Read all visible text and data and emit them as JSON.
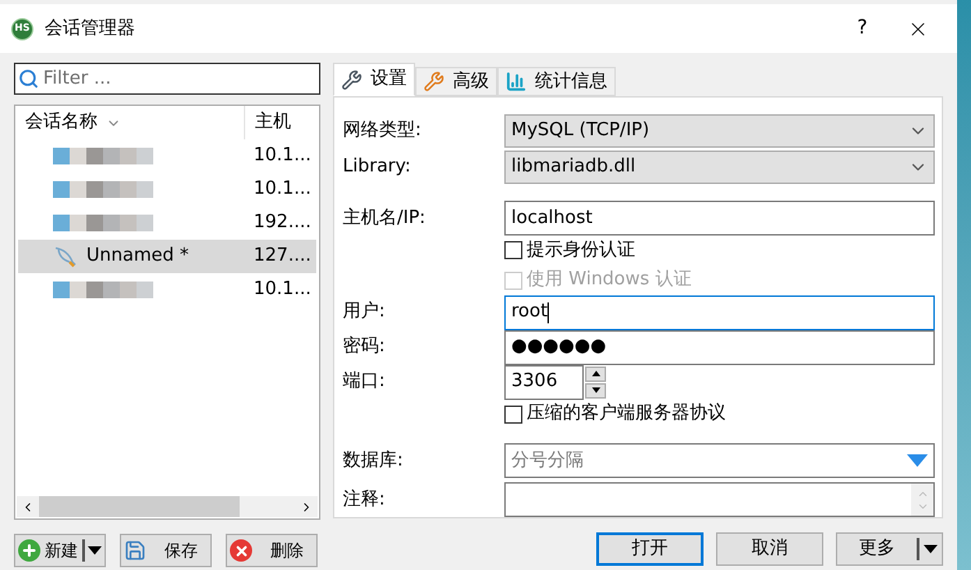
{
  "window": {
    "logo_text": "HS",
    "title": "会话管理器",
    "help": "?"
  },
  "filter": {
    "placeholder": "Filter ..."
  },
  "columns": [
    {
      "label": "会话名称",
      "sorted": true
    },
    {
      "label": "主机",
      "sorted": false
    }
  ],
  "sessions": [
    {
      "kind": "blurred",
      "host": "10.1...",
      "selected": false
    },
    {
      "kind": "blurred",
      "host": "10.1...",
      "selected": false
    },
    {
      "kind": "blurred",
      "host": "192....",
      "selected": false
    },
    {
      "kind": "named",
      "name": "Unnamed *",
      "host": "127....",
      "selected": true
    },
    {
      "kind": "blurred",
      "host": "10.1...",
      "selected": false
    }
  ],
  "left_buttons": [
    {
      "kind": "new",
      "label": "新建",
      "dropdown": true
    },
    {
      "kind": "save",
      "label": "保存",
      "dropdown": false
    },
    {
      "kind": "delete",
      "label": "删除",
      "dropdown": false
    }
  ],
  "tabs": [
    {
      "kind": "settings",
      "label": "设置",
      "selected": true
    },
    {
      "kind": "advanced",
      "label": "高级",
      "selected": false
    },
    {
      "kind": "stats",
      "label": "统计信息",
      "selected": false
    }
  ],
  "form": [
    {
      "kind": "select",
      "label": "网络类型:",
      "value": "MySQL (TCP/IP)"
    },
    {
      "kind": "select",
      "label": "Library:",
      "value": "libmariadb.dll"
    },
    {
      "kind": "gap"
    },
    {
      "kind": "text",
      "label": "主机名/IP:",
      "value": "localhost",
      "focused": false
    },
    {
      "kind": "checkbox",
      "label": "提示身份认证",
      "checked": false,
      "disabled": false
    },
    {
      "kind": "checkbox",
      "label": "使用 Windows 认证",
      "checked": false,
      "disabled": true
    },
    {
      "kind": "text",
      "label": "用户:",
      "value": "root",
      "focused": true
    },
    {
      "kind": "password",
      "label": "密码:",
      "value": "●●●●●●"
    },
    {
      "kind": "spinner",
      "label": "端口:",
      "value": "3306"
    },
    {
      "kind": "checkbox",
      "label": "压缩的客户端服务器协议",
      "checked": false,
      "disabled": false
    },
    {
      "kind": "gap"
    },
    {
      "kind": "combo",
      "label": "数据库:",
      "placeholder": "分号分隔"
    },
    {
      "kind": "textarea",
      "label": "注释:"
    }
  ],
  "bottom_buttons": [
    {
      "label": "打开",
      "default": true,
      "dropdown": false
    },
    {
      "label": "取消",
      "default": false,
      "dropdown": false
    },
    {
      "label": "更多",
      "default": false,
      "dropdown": true
    }
  ]
}
